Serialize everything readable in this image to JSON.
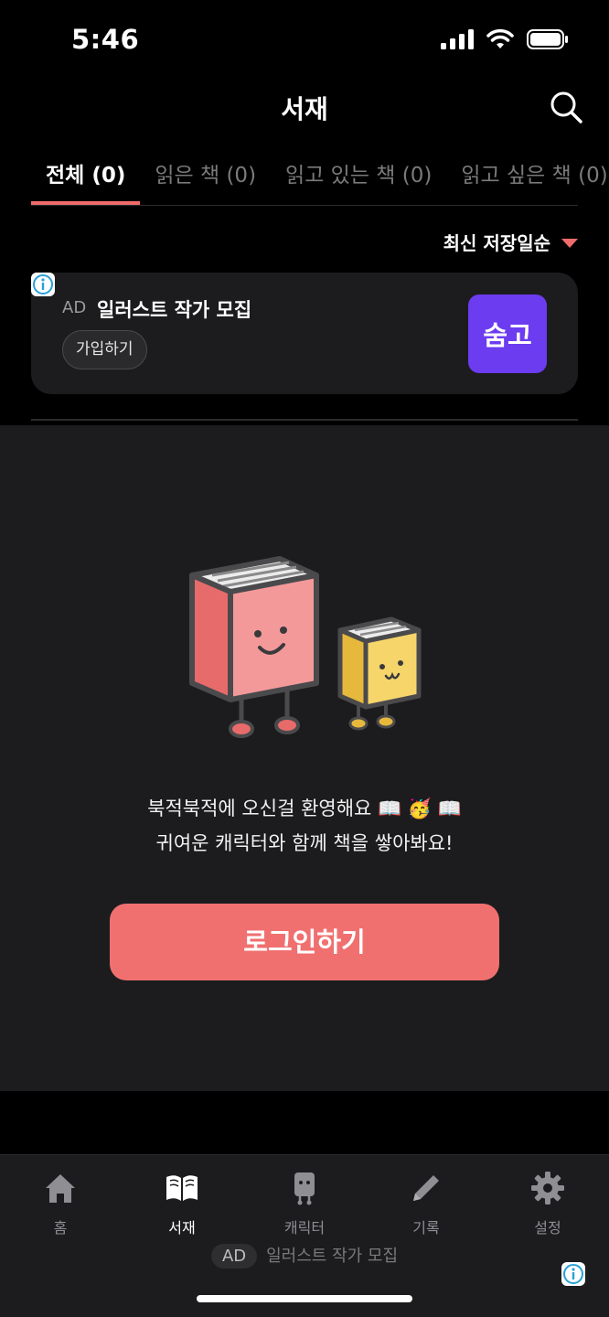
{
  "status_bar": {
    "time": "5:46"
  },
  "header": {
    "title": "서재"
  },
  "tabs": [
    {
      "label": "전체 (0)",
      "active": true
    },
    {
      "label": "읽은 책 (0)",
      "active": false
    },
    {
      "label": "읽고 있는 책 (0)",
      "active": false
    },
    {
      "label": "읽고 싶은 책 (0)",
      "active": false
    }
  ],
  "sort": {
    "label": "최신 저장일순"
  },
  "ad": {
    "tag": "AD",
    "title": "일러스트 작가 모집",
    "button_label": "가입하기",
    "logo_text": "숨고",
    "logo_color": "#6c3cf0"
  },
  "empty_state": {
    "line1": "북적북적에 오신걸 환영해요 📖 🥳 📖",
    "line2": "귀여운 캐릭터와 함께 책을 쌓아봐요!",
    "login_button": "로그인하기"
  },
  "tabbar": {
    "items": [
      {
        "label": "홈",
        "icon": "home-icon"
      },
      {
        "label": "서재",
        "icon": "book-icon"
      },
      {
        "label": "캐릭터",
        "icon": "character-icon"
      },
      {
        "label": "기록",
        "icon": "pencil-icon"
      },
      {
        "label": "설정",
        "icon": "gear-icon"
      }
    ],
    "active": "서재"
  },
  "bottom_ad": {
    "tag": "AD",
    "text": "일러스트 작가 모집"
  },
  "colors": {
    "accent": "#ef6b6b",
    "panel": "#1c1c1e",
    "background": "#000000"
  }
}
